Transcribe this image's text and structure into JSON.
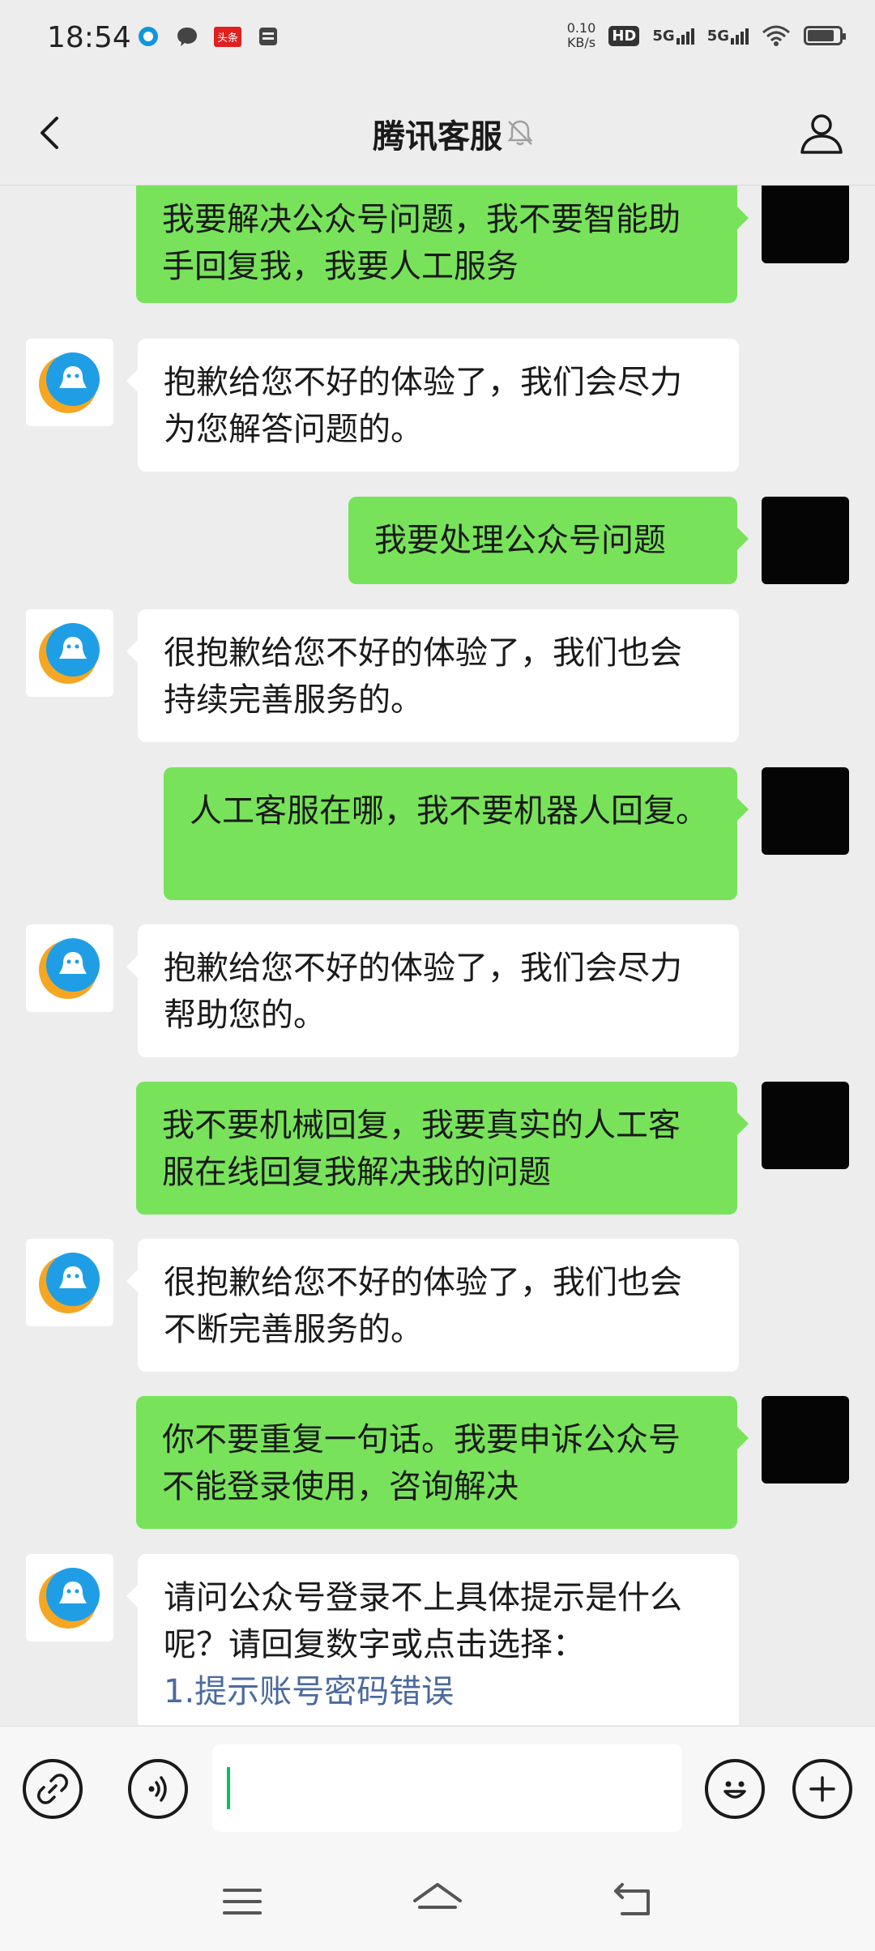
{
  "status_bar": {
    "time": "18:54",
    "speed_value": "0.10",
    "speed_unit": "KB/s",
    "hd_label": "HD",
    "sim1_label": "5G",
    "sim2_label": "5G",
    "news_badge": "头条",
    "battery_level": 0.85
  },
  "header": {
    "title": "腾讯客服",
    "back_icon": "chevron-left-icon",
    "mute_icon": "bell-off-icon",
    "profile_icon": "person-icon"
  },
  "messages": [
    {
      "side": "right",
      "text": "我要解决公众号问题，我不要智能助手回复我，我要人工服务"
    },
    {
      "side": "left",
      "text": "抱歉给您不好的体验了，我们会尽力为您解答问题的。"
    },
    {
      "side": "right",
      "text": "我要处理公众号问题"
    },
    {
      "side": "left",
      "text": "很抱歉给您不好的体验了，我们也会持续完善服务的。"
    },
    {
      "side": "right",
      "text": "人工客服在哪，我不要机器人回复。"
    },
    {
      "side": "left",
      "text": "抱歉给您不好的体验了，我们会尽力帮助您的。"
    },
    {
      "side": "right",
      "text": "我不要机械回复，我要真实的人工客服在线回复我解决我的问题"
    },
    {
      "side": "left",
      "text": "很抱歉给您不好的体验了，我们也会不断完善服务的。"
    },
    {
      "side": "right",
      "text": "你不要重复一句话。我要申诉公众号不能登录使用，咨询解决"
    },
    {
      "side": "left",
      "text": "请问公众号登录不上具体提示是什么呢？请回复数字或点击选择：",
      "option": "1.提示账号密码错误"
    }
  ],
  "input_bar": {
    "link_icon": "link-icon",
    "voice_icon": "voice-icon",
    "emoji_icon": "emoji-icon",
    "plus_icon": "plus-icon",
    "input_value": ""
  },
  "nav_bar": {
    "menu_icon": "menu-icon",
    "home_icon": "home-icon",
    "back_icon": "back-icon"
  },
  "colors": {
    "sent_bubble": "#78e35a",
    "received_bubble": "#ffffff",
    "background": "#ededed",
    "option_link": "#4b6a9e"
  }
}
